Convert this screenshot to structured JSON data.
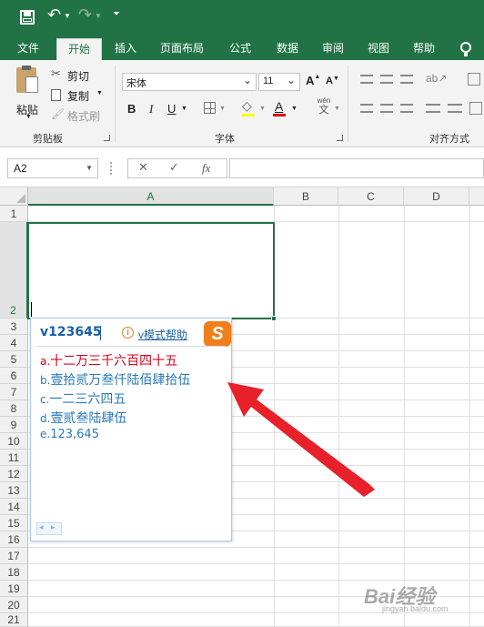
{
  "quick_access": {
    "save_icon": "save-icon",
    "undo_icon": "undo-icon",
    "redo_icon": "redo-icon",
    "customize_icon": "customize-icon"
  },
  "ribbon_tabs": [
    "文件",
    "开始",
    "插入",
    "页面布局",
    "公式",
    "数据",
    "审阅",
    "视图",
    "帮助"
  ],
  "active_tab": "开始",
  "clipboard": {
    "paste": "粘贴",
    "cut": "剪切",
    "copy": "复制",
    "format_painter": "格式刷",
    "group_label": "剪贴板"
  },
  "font": {
    "name": "宋体",
    "size": "11",
    "grow": "A",
    "shrink": "A",
    "bold": "B",
    "italic": "I",
    "underline": "U",
    "font_color": "A",
    "phonetic_top": "wén",
    "phonetic_bottom": "文",
    "group_label": "字体"
  },
  "alignment": {
    "group_label": "对齐方式"
  },
  "formula_bar": {
    "name_box": "A2",
    "cancel": "✕",
    "enter": "✓",
    "fx": "fx",
    "value": ""
  },
  "columns": [
    "A",
    "B",
    "C",
    "D"
  ],
  "rows": [
    "1",
    "2",
    "3",
    "4",
    "5",
    "6",
    "7",
    "8",
    "9",
    "10",
    "11",
    "12",
    "13",
    "14",
    "15",
    "16",
    "17",
    "18",
    "19",
    "20",
    "21"
  ],
  "ime": {
    "input": "v123645",
    "help_label": "v模式帮助",
    "logo": "S",
    "candidates": [
      {
        "prefix": "a.",
        "text": "十二万三千六百四十五"
      },
      {
        "prefix": "b.",
        "text": "壹拾贰万叁仟陆佰肆拾伍"
      },
      {
        "prefix": "c.",
        "text": "一二三六四五"
      },
      {
        "prefix": "d.",
        "text": "壹贰叁陆肆伍"
      },
      {
        "prefix": "e.",
        "text": "123,645"
      }
    ],
    "colors": {
      "first": "#d0021b",
      "rest": "#2a7ab8"
    }
  },
  "watermark": {
    "text": "Bai经验",
    "sub": "jingyan.baidu.com"
  },
  "colors": {
    "excel_green": "#217346",
    "arrow_red": "#e8202a"
  }
}
